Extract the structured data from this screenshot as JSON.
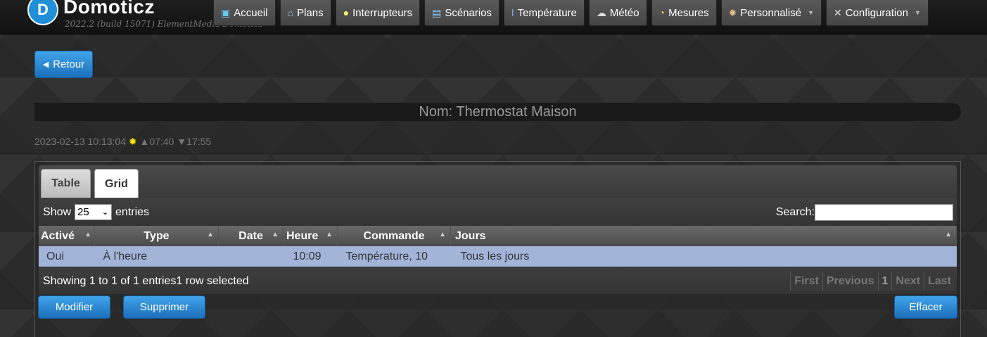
{
  "app": {
    "brand": "Domoticz",
    "version": "2022.2 (build 15071) ElementMedia Domoticz"
  },
  "nav": [
    {
      "label": "Accueil",
      "icon": "monitor-icon"
    },
    {
      "label": "Plans",
      "icon": "house-icon"
    },
    {
      "label": "Interrupteurs",
      "icon": "lightbulb-icon"
    },
    {
      "label": "Scénarios",
      "icon": "clapperboard-icon"
    },
    {
      "label": "Température",
      "icon": "thermometer-icon"
    },
    {
      "label": "Météo",
      "icon": "rain-cloud-icon"
    },
    {
      "label": "Mesures",
      "icon": "gauge-icon"
    },
    {
      "label": "Personnalisé",
      "icon": "gear-icon",
      "dropdown": true
    },
    {
      "label": "Configuration",
      "icon": "tools-icon",
      "dropdown": true
    }
  ],
  "back_label": "Retour",
  "title": "Nom: Thermostat Maison",
  "sun": {
    "datetime": "2023-02-13 10:13:04",
    "sunrise": "▲07:40",
    "sunset": "▼17:55"
  },
  "tabs": {
    "table": "Table",
    "grid": "Grid"
  },
  "length": {
    "show": "Show",
    "value": "25",
    "entries": "entries"
  },
  "search_label": "Search:",
  "columns": [
    "Activé",
    "Type",
    "Date",
    "Heure",
    "Commande",
    "Jours"
  ],
  "rows": [
    {
      "active": "Oui",
      "type": "À l'heure",
      "date": "",
      "time": "10:09",
      "command": "Température, 10",
      "days": "Tous les jours"
    }
  ],
  "info": "Showing 1 to 1 of 1 entries1 row selected",
  "pager": {
    "first": "First",
    "previous": "Previous",
    "page": "1",
    "next": "Next",
    "last": "Last"
  },
  "buttons": {
    "modify": "Modifier",
    "delete": "Supprimer",
    "clear": "Effacer"
  }
}
